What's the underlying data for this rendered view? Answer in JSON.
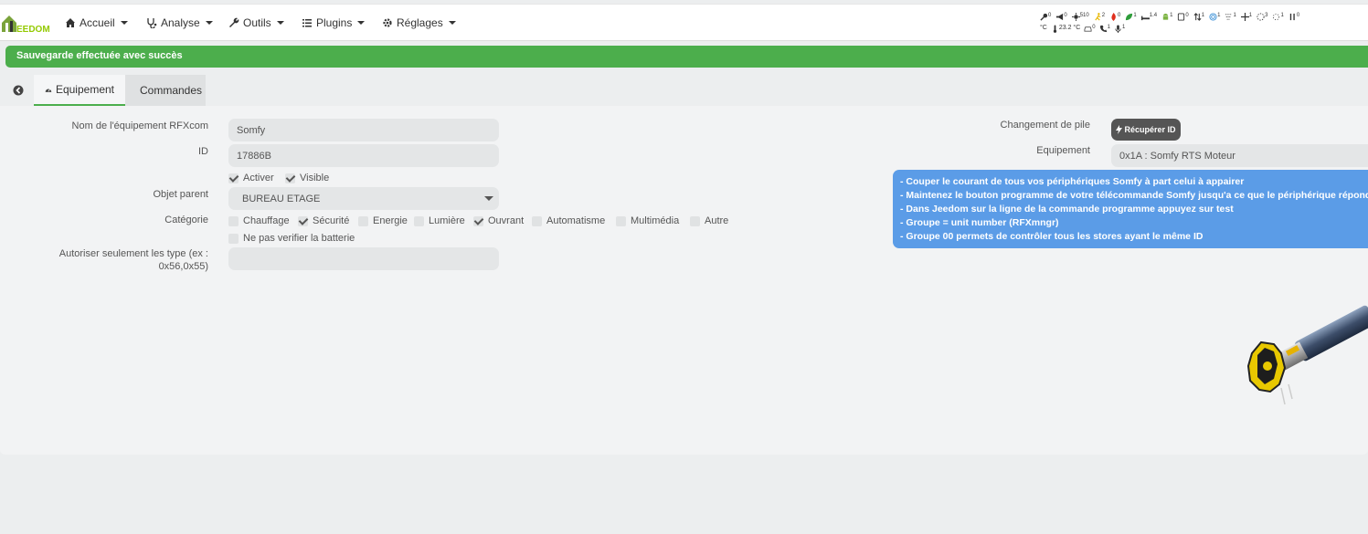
{
  "app": {
    "logo_text": "EEDOM"
  },
  "navbar": {
    "items": [
      {
        "label": "Accueil",
        "icon": "home-icon"
      },
      {
        "label": "Analyse",
        "icon": "stethoscope-icon"
      },
      {
        "label": "Outils",
        "icon": "wrench-icon"
      },
      {
        "label": "Plugins",
        "icon": "list-icon"
      },
      {
        "label": "Réglages",
        "icon": "gear-icon"
      }
    ]
  },
  "summary": {
    "row1": [
      {
        "icon": "key-icon",
        "value": "0"
      },
      {
        "icon": "megaphone-icon",
        "value": "0"
      },
      {
        "icon": "light-icon",
        "value": "510"
      },
      {
        "icon": "running-man-icon",
        "value": "2"
      },
      {
        "icon": "fire-icon",
        "value": "0"
      },
      {
        "icon": "leaf-icon",
        "value": "1"
      },
      {
        "icon": "bed-icon",
        "value": "1.4"
      },
      {
        "icon": "android-icon",
        "value": "1"
      },
      {
        "icon": "tablet-icon",
        "value": "0"
      },
      {
        "icon": "arrows-updown-icon",
        "value": "1"
      },
      {
        "icon": "target-icon",
        "value": "1"
      },
      {
        "icon": "blinds-icon",
        "value": "1"
      },
      {
        "icon": "move-icon",
        "value": "1"
      },
      {
        "icon": "circle-dots-icon",
        "value": "3"
      },
      {
        "icon": "circle-dots-small-icon",
        "value": "1"
      },
      {
        "icon": "pause-bars-icon",
        "value": "0"
      }
    ],
    "row2": [
      {
        "label": "°C",
        "icon": "thermometer-icon",
        "value": "23.2 °C"
      },
      {
        "icon": "car-icon",
        "value": "0"
      },
      {
        "icon": "phone-icon",
        "value": "1"
      },
      {
        "icon": "microphone-icon",
        "value": "1"
      }
    ]
  },
  "alert": {
    "message": "Sauvegarde effectuée avec succès",
    "color": "#4cae4c"
  },
  "tabs": [
    {
      "label": "Equipement",
      "icon": "dashboard-icon",
      "active": true
    },
    {
      "label": "Commandes",
      "icon": "table-list-icon",
      "active": false
    }
  ],
  "form": {
    "name_label": "Nom de l'équipement RFXcom",
    "name_value": "Somfy",
    "id_label": "ID",
    "id_value": "17886B",
    "activer_label": "Activer",
    "visible_label": "Visible",
    "parent_label": "Objet parent",
    "parent_value": "BUREAU ETAGE",
    "category_label": "Catégorie",
    "categories": [
      {
        "label": "Chauffage",
        "checked": false
      },
      {
        "label": "Sécurité",
        "checked": true
      },
      {
        "label": "Energie",
        "checked": false
      },
      {
        "label": "Lumière",
        "checked": false
      },
      {
        "label": "Ouvrant",
        "checked": true
      },
      {
        "label": "Automatisme",
        "checked": false
      },
      {
        "label": "Multimédia",
        "checked": false
      },
      {
        "label": "Autre",
        "checked": false
      }
    ],
    "battery_label": "Ne pas verifier la batterie",
    "types_label_1": "Autoriser seulement les type (ex :",
    "types_label_2": "0x56,0x55)",
    "types_value": ""
  },
  "right": {
    "pile_label": "Changement de pile",
    "recover_button": "Récupérer ID",
    "equipement_label": "Equipement",
    "equipement_value": "0x1A : Somfy RTS Moteur",
    "info_lines": [
      "- Couper le courant de tous vos périphériques Somfy à part celui à appairer",
      "- Maintenez le bouton programme de votre télécommande Somfy jusqu'a ce que le périphérique répond",
      "- Dans Jeedom sur la ligne de la commande programme appuyez sur test",
      "- Groupe = unit number (RFXmngr)",
      "- Groupe 00 permets de contrôler tous les stores ayant le même ID"
    ]
  }
}
